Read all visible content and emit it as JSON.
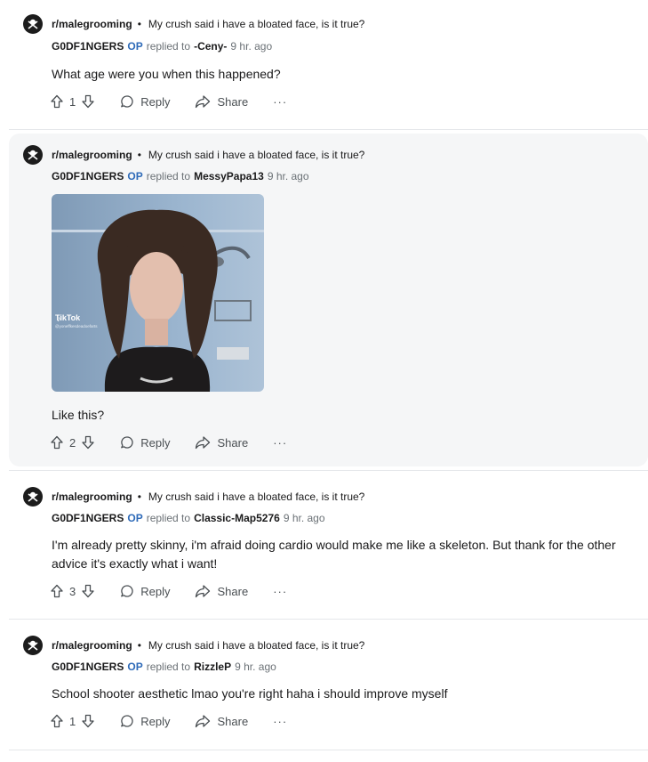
{
  "comments": [
    {
      "subreddit": "r/malegrooming",
      "post_title": "My crush said i have a bloated face, is it true?",
      "author": "G0DF1NGERS",
      "op_badge": "OP",
      "replied_to_label": "replied to",
      "replied_to": "-Ceny-",
      "time": "9 hr. ago",
      "text": "What age were you when this happened?",
      "score": "1",
      "reply_label": "Reply",
      "share_label": "Share",
      "more_label": "···"
    },
    {
      "subreddit": "r/malegrooming",
      "post_title": "My crush said i have a bloated face, is it true?",
      "author": "G0DF1NGERS",
      "op_badge": "OP",
      "replied_to_label": "replied to",
      "replied_to": "MessyPapa13",
      "time": "9 hr. ago",
      "image_watermark": "TikTok",
      "image_watermark_handle": "@yoneffkesdeadoefarts",
      "text": "Like this?",
      "score": "2",
      "reply_label": "Reply",
      "share_label": "Share",
      "more_label": "···"
    },
    {
      "subreddit": "r/malegrooming",
      "post_title": "My crush said i have a bloated face, is it true?",
      "author": "G0DF1NGERS",
      "op_badge": "OP",
      "replied_to_label": "replied to",
      "replied_to": "Classic-Map5276",
      "time": "9 hr. ago",
      "text": "I'm already pretty skinny, i'm afraid doing cardio would make me like a skeleton. But thank for the other advice it's exactly what i want!",
      "score": "3",
      "reply_label": "Reply",
      "share_label": "Share",
      "more_label": "···"
    },
    {
      "subreddit": "r/malegrooming",
      "post_title": "My crush said i have a bloated face, is it true?",
      "author": "G0DF1NGERS",
      "op_badge": "OP",
      "replied_to_label": "replied to",
      "replied_to": "RizzleP",
      "time": "9 hr. ago",
      "text": "School shooter aesthetic lmao you're right haha i should improve myself",
      "score": "1",
      "reply_label": "Reply",
      "share_label": "Share",
      "more_label": "···"
    }
  ],
  "colors": {
    "op_blue": "#2e6ab8",
    "muted": "#6b7176",
    "highlight_bg": "#f5f6f7"
  },
  "icons": [
    "subreddit-avatar-icon",
    "upvote-icon",
    "downvote-icon",
    "reply-bubble-icon",
    "share-icon",
    "more-icon"
  ]
}
